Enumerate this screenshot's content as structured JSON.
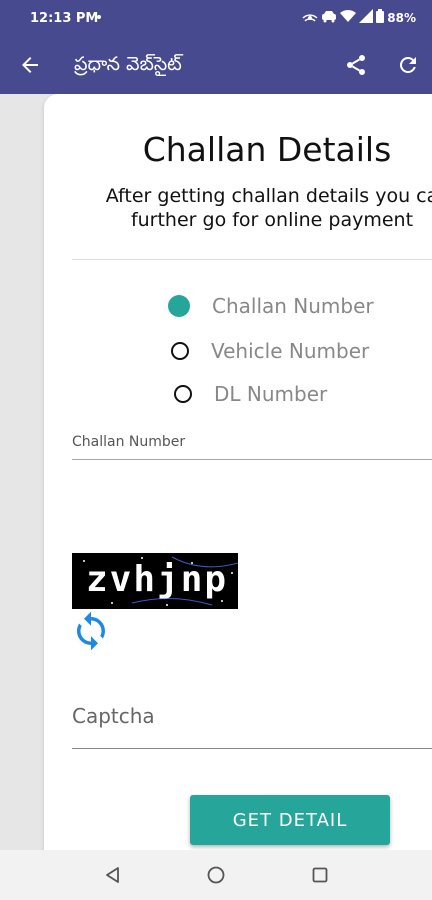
{
  "status": {
    "time": "12:13 PM",
    "battery": "88%"
  },
  "appbar": {
    "title": "ప్రధాన వెబ్‌సైట్"
  },
  "card": {
    "title": "Challan Details",
    "subtitle_line1": "After getting challan details you ca",
    "subtitle_line2": "further go for online payment"
  },
  "search_type": {
    "options": [
      {
        "label": "Challan Number",
        "selected": true
      },
      {
        "label": "Vehicle Number",
        "selected": false
      },
      {
        "label": "DL Number",
        "selected": false
      }
    ]
  },
  "challan_field": {
    "label": "Challan Number"
  },
  "captcha": {
    "image_text": "zvhjnp",
    "input_placeholder": "Captcha"
  },
  "actions": {
    "get_detail_label": "GET DETAIL"
  },
  "colors": {
    "appbar": "#474a8e",
    "accent": "#26a69a",
    "refresh_icon": "#1e88e5"
  }
}
